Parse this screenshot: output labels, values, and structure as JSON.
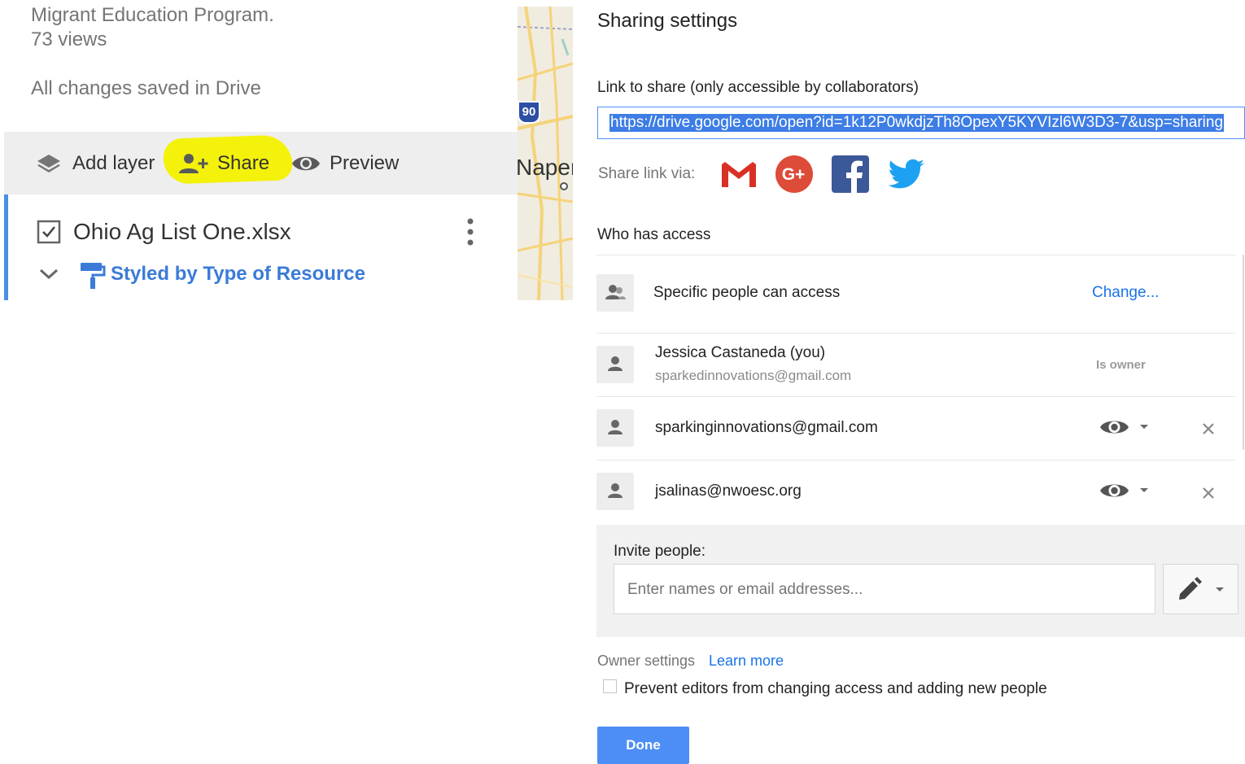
{
  "left_panel": {
    "description": "Migrant Education Program.",
    "views": "73 views",
    "save_status": "All changes saved in Drive",
    "toolbar": {
      "add_layer": "Add layer",
      "share": "Share",
      "preview": "Preview"
    },
    "layer": {
      "name": "Ohio Ag List One.xlsx",
      "style": "Styled by Type of Resource"
    }
  },
  "map": {
    "highway_shield": "90",
    "city_label": "Naper"
  },
  "dialog": {
    "title": "Sharing settings",
    "link_label": "Link to share (only accessible by collaborators)",
    "link_url": "https://drive.google.com/open?id=1k12P0wkdjzTh8OpexY5KYVIzl6W3D3-7&usp=sharing",
    "share_via_label": "Share link via:",
    "share_services": [
      "gmail-icon",
      "google-plus-icon",
      "facebook-icon",
      "twitter-icon"
    ],
    "who_has_access_label": "Who has access",
    "access_level": {
      "text": "Specific people can access",
      "change": "Change..."
    },
    "people": [
      {
        "name": "Jessica Castaneda (you)",
        "email": "sparkedinnovations@gmail.com",
        "role": "Is owner"
      },
      {
        "email": "sparkinginnovations@gmail.com",
        "permission_icon": "eye-icon"
      },
      {
        "email": "jsalinas@nwoesc.org",
        "permission_icon": "eye-icon"
      }
    ],
    "invite": {
      "label": "Invite people:",
      "placeholder": "Enter names or email addresses...",
      "permission_icon": "pencil-icon"
    },
    "owner_settings": {
      "label": "Owner settings",
      "learn_more": "Learn more",
      "prevent_label": "Prevent editors from changing access and adding new people",
      "prevent_checked": false
    },
    "done": "Done"
  },
  "colors": {
    "accent_blue": "#4d8ef6",
    "link_blue": "#1a73e8",
    "highlight_yellow": "#f4f20a",
    "gmail_red": "#d93025",
    "gplus_red": "#dd4b39",
    "facebook_blue": "#3b5998",
    "twitter_blue": "#1da1f2"
  }
}
